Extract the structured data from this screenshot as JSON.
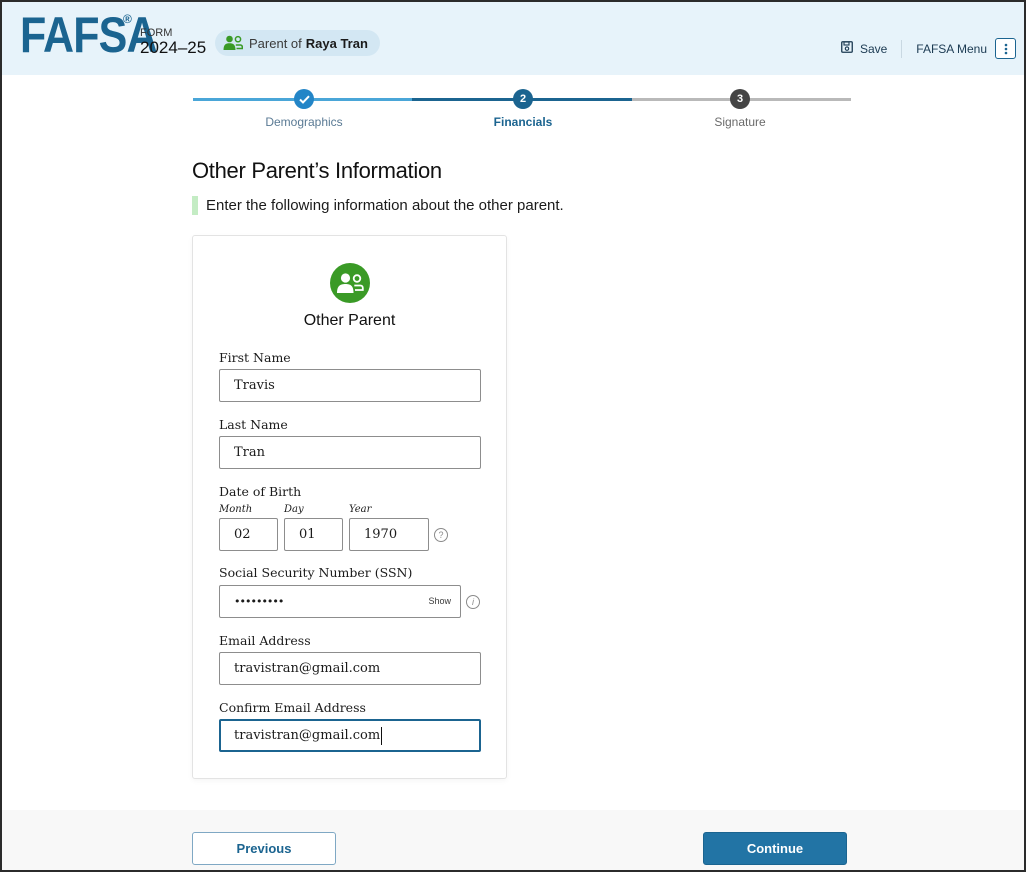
{
  "header": {
    "logo": "FAFSA",
    "logo_mark": "®",
    "form_label": "FORM",
    "form_year": "2024–25",
    "role_prefix": "Parent of",
    "role_name": "Raya Tran",
    "save_label": "Save",
    "menu_label": "FAFSA Menu"
  },
  "stepper": {
    "steps": [
      {
        "label": "Demographics",
        "number": "1",
        "state": "complete"
      },
      {
        "label": "Financials",
        "number": "2",
        "state": "current"
      },
      {
        "label": "Signature",
        "number": "3",
        "state": "upcoming"
      }
    ]
  },
  "page": {
    "title": "Other Parent’s Information",
    "instruction": "Enter the following information about the other parent."
  },
  "card": {
    "title": "Other Parent",
    "fields": {
      "first_name": {
        "label": "First Name",
        "value": "Travis"
      },
      "last_name": {
        "label": "Last Name",
        "value": "Tran"
      },
      "dob": {
        "label": "Date of Birth",
        "month_label": "Month",
        "month": "02",
        "day_label": "Day",
        "day": "01",
        "year_label": "Year",
        "year": "1970"
      },
      "ssn": {
        "label": "Social Security Number (SSN)",
        "value": "•••••••••",
        "show_label": "Show"
      },
      "email": {
        "label": "Email Address",
        "value": "travistran@gmail.com"
      },
      "confirm_email": {
        "label": "Confirm Email Address",
        "value": "travistran@gmail.com"
      }
    }
  },
  "footer": {
    "previous_label": "Previous",
    "continue_label": "Continue"
  },
  "colors": {
    "brand": "#1b6490",
    "header_bg": "#e7f3fa",
    "accent_green": "#3a9a26",
    "continue_bg": "#2274a5"
  }
}
